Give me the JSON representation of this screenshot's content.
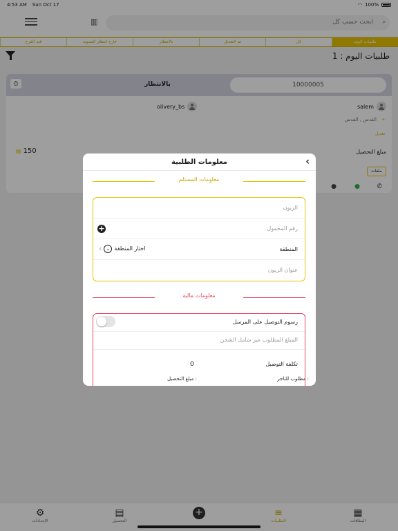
{
  "status_bar": {
    "time": "4:53 AM",
    "date": "Sun Oct 17",
    "battery": "100%"
  },
  "header": {
    "search_placeholder": "ابحث حسب كل"
  },
  "tabs": [
    {
      "label": "كل"
    },
    {
      "label": "تم التعديل"
    },
    {
      "label": "بالانتظار"
    },
    {
      "label": "خارج انتظار التسوية"
    },
    {
      "label": "قيد الفرع"
    },
    {
      "label": "طلبيات اليوم"
    }
  ],
  "page": {
    "today_orders": "طلبيات اليوم : 1"
  },
  "order_card": {
    "order_number": "10000005",
    "status": "بالانتظار",
    "customer": "salem",
    "driver": "olivery_bs",
    "location": "القدس , القدس",
    "edit_tag": "تعديل",
    "amount_label": "مبلغ التحصيل",
    "amount": "150",
    "currency_icon": "banknote-icon",
    "file_button": "ملفات"
  },
  "modal": {
    "title": "معلومات الطلبية",
    "receiver_section": "معلومات المستلم",
    "customer_placeholder": "الزبون",
    "mobile_placeholder": "رقم المحمول",
    "region_label": "المنطقة",
    "region_select": "اختار المنطقة",
    "address_placeholder": "عنوان الزبون",
    "financial_section": "معلومات مالية",
    "fees_on_sender": "رسوم التوصيل على المرسل",
    "amount_placeholder": "المبلغ المطلوب غير شامل الشحن",
    "delivery_cost_label": "تكلفة التوصيل",
    "delivery_cost_value": "0",
    "required_for_merchant": "مطلوب للتاجر :",
    "collection_amount": "مبلغ التحصيل :"
  },
  "bottom_nav": [
    {
      "label": "الإعدادات",
      "icon": "gear-icon"
    },
    {
      "label": "التحصيل",
      "icon": "document-icon"
    },
    {
      "label": "الطلبيات",
      "icon": "list-icon"
    },
    {
      "label": "البطاقات",
      "icon": "grid-icon"
    }
  ],
  "colors": {
    "accent": "#e8c300",
    "danger": "#e0455a"
  }
}
